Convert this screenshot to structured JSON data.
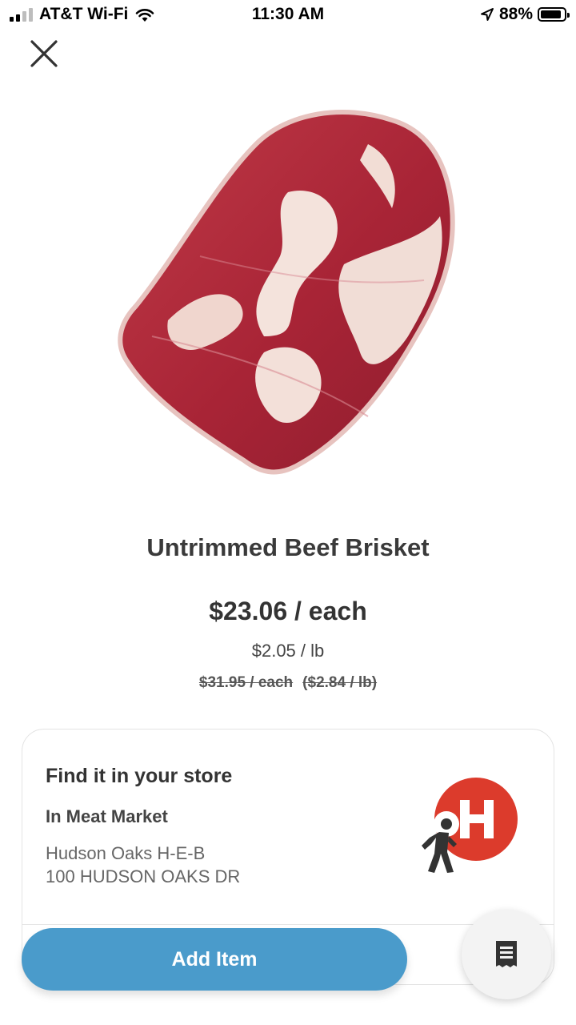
{
  "status_bar": {
    "carrier": "AT&T Wi-Fi",
    "time": "11:30 AM",
    "battery_percent": "88%",
    "battery_level": 0.88
  },
  "icons": {
    "close": "close-icon",
    "wifi": "wifi-icon",
    "location": "location-arrow-icon",
    "store_walk": "heb-walking-person-icon",
    "receipt": "receipt-icon"
  },
  "product": {
    "title": "Untrimmed Beef Brisket",
    "price": "$23.06 / each",
    "unit_price": "$2.05 / lb",
    "original_price": "$31.95 / each",
    "original_unit_price": "($2.84 / lb)"
  },
  "store_card": {
    "heading": "Find it in your store",
    "location": "In Meat Market",
    "store_name": "Hudson Oaks H-E-B",
    "address": "100 HUDSON OAKS DR"
  },
  "actions": {
    "add_item_label": "Add Item"
  },
  "colors": {
    "accent": "#4a9bcb",
    "heb_red": "#dc3b2c",
    "meat_red": "#b32a3a"
  }
}
